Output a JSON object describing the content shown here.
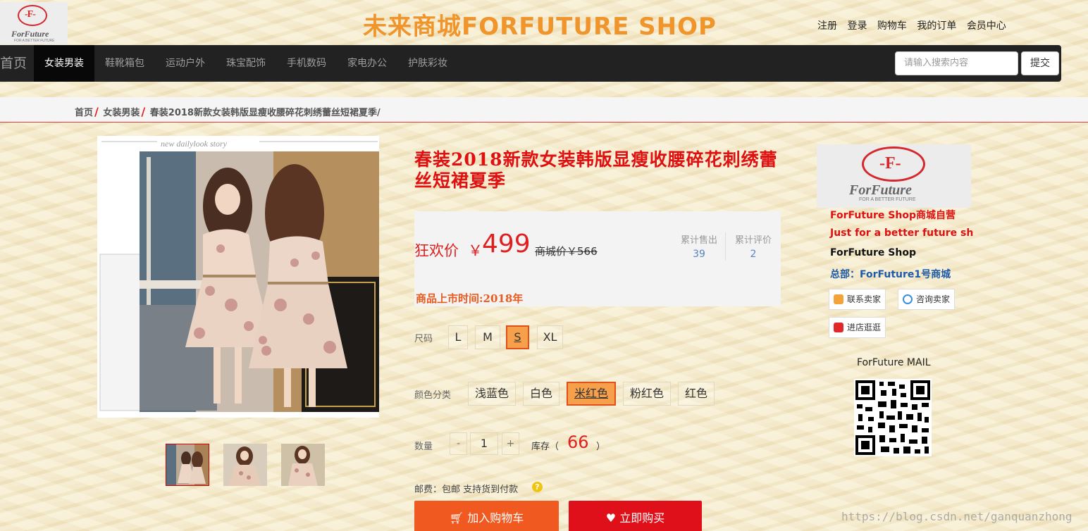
{
  "header": {
    "logo_text": "ForFuture",
    "logo_tagline": "FOR A BETTER FUTURE",
    "site_title": "未来商城FORFUTURE SHOP",
    "top_links": [
      "注册",
      "登录",
      "购物车",
      "我的订单",
      "会员中心"
    ]
  },
  "nav": {
    "home": "首页",
    "items": [
      "女装男装",
      "鞋靴箱包",
      "运动户外",
      "珠宝配饰",
      "手机数码",
      "家电办公",
      "护肤彩妆"
    ],
    "active_index": 0,
    "search_placeholder": "请输入搜索内容",
    "submit": "提交"
  },
  "breadcrumb": [
    "首页",
    "女装男装",
    "春装2018新款女装韩版显瘦收腰碎花刺绣蕾丝短裙夏季"
  ],
  "product": {
    "title": "春装2018新款女装韩版显瘦收腰碎花刺绣蕾丝短裙夏季",
    "price_label": "狂欢价",
    "currency": "￥",
    "price": "499",
    "original_price": "商城价￥566",
    "sold_label": "累计售出",
    "sold": "39",
    "reviews_label": "累计评价",
    "reviews": "2",
    "launch_time": "商品上市时间:2018年",
    "size_label": "尺码",
    "sizes": [
      "L",
      "M",
      "S",
      "XL"
    ],
    "selected_size": "S",
    "color_label": "颜色分类",
    "colors": [
      "浅蓝色",
      "白色",
      "米红色",
      "粉红色",
      "红色"
    ],
    "selected_color": "米红色",
    "quantity_label": "数量",
    "quantity": "1",
    "minus": "-",
    "plus": "+",
    "stock_label": "库存（",
    "stock": "66",
    "stock_close": "）",
    "shipping": "邮费：包邮   支持货到付款",
    "add_to_cart": "加入购物车",
    "buy_now": "立即购买",
    "image_caption": "new dailylook story"
  },
  "shop": {
    "logo_text": "ForFuture",
    "logo_tagline": "FOR A BETTER FUTURE",
    "line1": "ForFuture Shop商城自营",
    "line2": "Just for a better future sh",
    "line3": "ForFuture Shop",
    "line4": "总部：ForFuture1号商城",
    "contact_seller": "联系卖家",
    "consult_seller": "咨询卖家",
    "visit_store": "进店逛逛",
    "mail_title": "ForFuture MAIL"
  },
  "watermark": "https://blog.csdn.net/ganquanzhong",
  "colors": {
    "accent_red": "#e02020",
    "orange": "#f05a20",
    "title_orange": "#f0952b",
    "nav_bg": "#222222"
  }
}
